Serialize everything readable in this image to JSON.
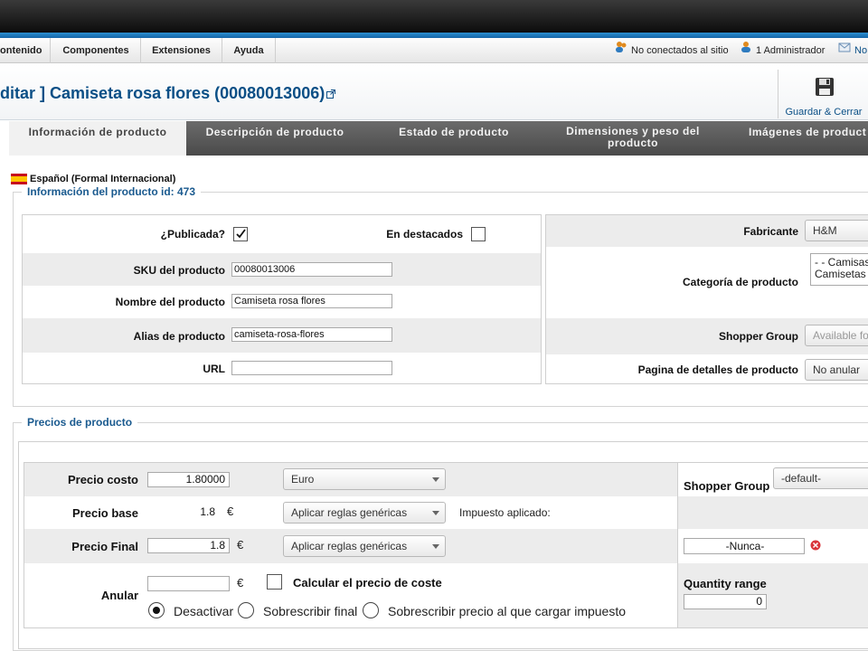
{
  "menu": {
    "items": [
      "ontenido",
      "Componentes",
      "Extensiones",
      "Ayuda"
    ],
    "status_visitors": "No conectados al sitio",
    "status_admins": "1 Administrador",
    "status_messages": "No"
  },
  "header": {
    "prefix": "ditar ]",
    "title": "Camiseta rosa flores (00080013006)",
    "save_close_label": "Guardar & Cerrar"
  },
  "tabs": [
    {
      "label": "Información de producto",
      "active": true
    },
    {
      "label": "Descripción de producto",
      "active": false
    },
    {
      "label": "Estado de producto",
      "active": false
    },
    {
      "label": "Dimensiones y peso del producto",
      "active": false
    },
    {
      "label": "Imágenes de product",
      "active": false
    }
  ],
  "language": "Español (Formal Internacional)",
  "product_info": {
    "legend": "Información del producto id: 473",
    "published_label": "¿Publicada?",
    "published": true,
    "featured_label": "En destacados",
    "featured": false,
    "sku_label": "SKU del producto",
    "sku": "00080013006",
    "name_label": "Nombre del producto",
    "name": "Camiseta rosa flores",
    "alias_label": "Alias de producto",
    "alias": "camiseta-rosa-flores",
    "url_label": "URL",
    "url": "",
    "manufacturer_label": "Fabricante",
    "manufacturer": "H&M",
    "category_label": "Categoría de producto",
    "categories": [
      "- - Camisas",
      "Camisetas"
    ],
    "shopper_group_label": "Shopper Group",
    "shopper_group_placeholder": "Available for",
    "details_page_label": "Pagina de detalles de producto",
    "details_page": "No anular"
  },
  "prices": {
    "legend": "Precios de producto",
    "cost_label": "Precio costo",
    "cost": "1.80000",
    "currency": "Euro",
    "base_label": "Precio base",
    "base": "1.8",
    "currency_symbol": "€",
    "base_rule": "Aplicar reglas genéricas",
    "tax_applied_label": "Impuesto aplicado:",
    "final_label": "Precio Final",
    "final": "1.8",
    "final_rule": "Aplicar reglas genéricas",
    "override_label": "Anular",
    "override": "",
    "calc_cost_label": "Calcular el precio de coste",
    "radio_disable": "Desactivar",
    "radio_override_final": "Sobrescribir final",
    "radio_override_tax": "Sobrescribir precio al que cargar impuesto",
    "shopper_group_label": "Shopper Group",
    "shopper_group": "-default-",
    "date_value": "-Nunca-",
    "quantity_range_label": "Quantity range",
    "quantity_range": "0"
  },
  "colors": {
    "accent": "#0a4f86",
    "topbar": "#1565a8",
    "delete": "#d9343a"
  }
}
